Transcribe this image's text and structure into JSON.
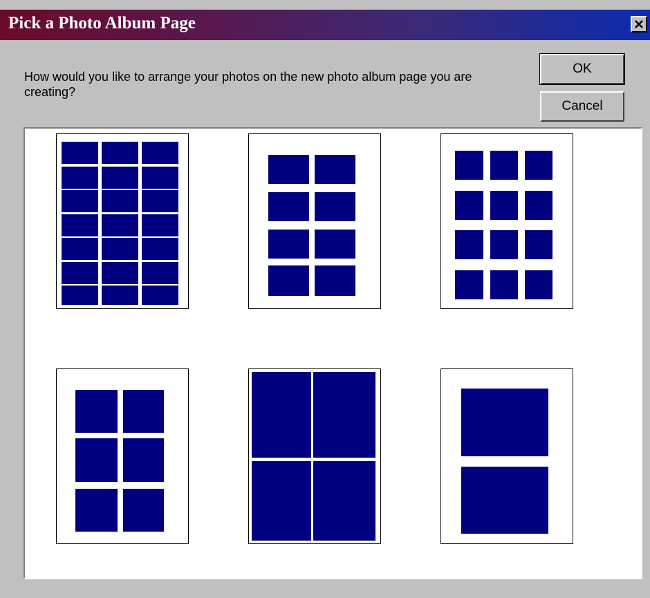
{
  "dialog": {
    "title": "Pick a Photo Album Page",
    "close_label": "X",
    "prompt": "How would you like to arrange your photos on the new photo album page you are creating?",
    "ok_label": "OK",
    "cancel_label": "Cancel"
  },
  "layouts": [
    {
      "columns": 3,
      "rows": 7,
      "photos": 21
    },
    {
      "columns": 2,
      "rows": 4,
      "photos": 8
    },
    {
      "columns": 3,
      "rows": 4,
      "photos": 12
    },
    {
      "columns": 2,
      "rows": 3,
      "photos": 6
    },
    {
      "columns": 2,
      "rows": 2,
      "photos": 4
    },
    {
      "columns": 1,
      "rows": 2,
      "photos": 2
    }
  ],
  "colors": {
    "photo_fill": "#000080",
    "page_fill": "#ffffff",
    "dialog_face": "#c0c0c0"
  }
}
